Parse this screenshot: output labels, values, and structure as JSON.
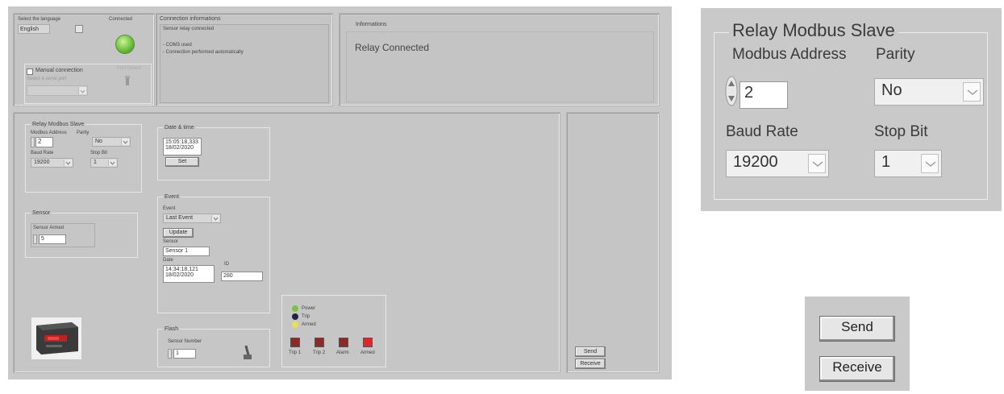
{
  "lang": {
    "label": "Select the language",
    "value": "English",
    "status": "Connected"
  },
  "manual": {
    "label": "Manual connection",
    "port_label": "Select a serial port",
    "port_value": "",
    "detect_label": "Port Detect"
  },
  "conn_info": {
    "title": "Connection informations",
    "lines": [
      "Sensor relay connected",
      "- COM3 used",
      "- Connection performed automatically"
    ]
  },
  "informations": {
    "title": "Informations",
    "text": "Relay Connected"
  },
  "modbus": {
    "title": "Relay Modbus Slave",
    "address_label": "Modbus Address",
    "parity_label": "Parity",
    "address_value": "2",
    "parity_value": "No",
    "baud_label": "Baud Rate",
    "stop_label": "Stop Bit",
    "baud_value": "19200",
    "stop_value": "1"
  },
  "datetime": {
    "title": "Date & time",
    "time": "15:05:18,333",
    "date": "18/02/2020",
    "set_label": "Set"
  },
  "sensor": {
    "title": "Sensor",
    "armed_label": "Sensor Armed",
    "armed_value": "5"
  },
  "event": {
    "title": "Event",
    "select_label": "Event",
    "select_value": "Last Event",
    "update_label": "Update",
    "sensor_label": "Sensor",
    "sensor_value": "Sensor 1",
    "date_label": "Date",
    "time": "14:34:18,121",
    "date": "18/02/2020",
    "id_label": "ID",
    "id_value": "280"
  },
  "flash": {
    "title": "Flash",
    "number_label": "Sensor Number",
    "number_value": "1"
  },
  "status": {
    "power": "Power",
    "trip": "Trip",
    "armed": "Armed",
    "colors": {
      "power": "#7fc241",
      "trip": "#222244",
      "armed": "#e8e050"
    }
  },
  "outputs": {
    "items": [
      "Trip 1",
      "Trip 2",
      "Alarm",
      "Armed"
    ],
    "colors": [
      "#8b2a26",
      "#8b2a26",
      "#8b2a26",
      "#e0262a"
    ]
  },
  "buttons": {
    "send": "Send",
    "receive": "Receive"
  },
  "zoom_modbus": {
    "title": "Relay Modbus Slave",
    "address_label": "Modbus Address",
    "parity_label": "Parity",
    "address_value": "2",
    "parity_value": "No",
    "baud_label": "Baud Rate",
    "stop_label": "Stop Bit",
    "baud_value": "19200",
    "stop_value": "1"
  },
  "zoom_buttons": {
    "send": "Send",
    "receive": "Receive"
  },
  "colors": {
    "panel": "#c9c9c9",
    "led_connected": "#6fc03b"
  }
}
